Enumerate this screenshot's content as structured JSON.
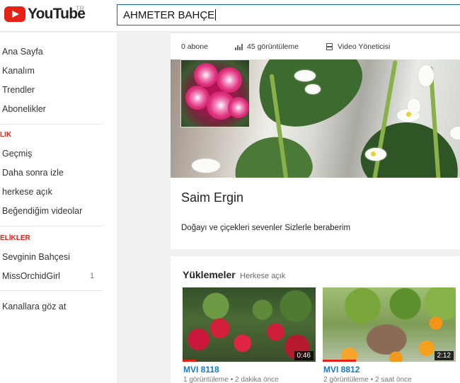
{
  "header": {
    "logo_text": "YouTube",
    "region": "TR",
    "search_value": "AHMETER BAHÇE"
  },
  "sidebar": {
    "main_items": [
      {
        "label": "Ana Sayfa"
      },
      {
        "label": "Kanalım"
      },
      {
        "label": "Trendler"
      },
      {
        "label": "Abonelikler"
      }
    ],
    "library_heading": "LIK",
    "library_items": [
      {
        "label": "Geçmiş"
      },
      {
        "label": "Daha sonra izle"
      },
      {
        "label": "herkese açık"
      },
      {
        "label": "Beğendiğim videolar"
      }
    ],
    "subscriptions_heading": "ELİKLER",
    "subscriptions": [
      {
        "label": "Sevginin Bahçesi",
        "count": ""
      },
      {
        "label": "MissOrchidGirl",
        "count": "1"
      }
    ],
    "browse_channels": "Kanallara göz at"
  },
  "channel": {
    "subscribers": "0 abone",
    "views": "45 görüntüleme",
    "video_manager": "Video Yöneticisi",
    "name": "Saim Ergin",
    "description": "Doğayı ve çiçekleri sevenler Sizlerle beraberim"
  },
  "uploads": {
    "title": "Yüklemeler",
    "subtitle": "Herkese açık",
    "videos": [
      {
        "title": "MVI 8118",
        "duration": "0:46",
        "meta": "1 görüntüleme • 2 dakika önce",
        "progress": 0.1
      },
      {
        "title": "MVI 8812",
        "duration": "2:12",
        "meta": "2 görüntüleme • 2 saat önce",
        "progress": 0.25
      }
    ]
  },
  "colors": {
    "brand_red": "#e62117",
    "link_blue": "#167ac6",
    "search_border": "#1c62b9"
  }
}
